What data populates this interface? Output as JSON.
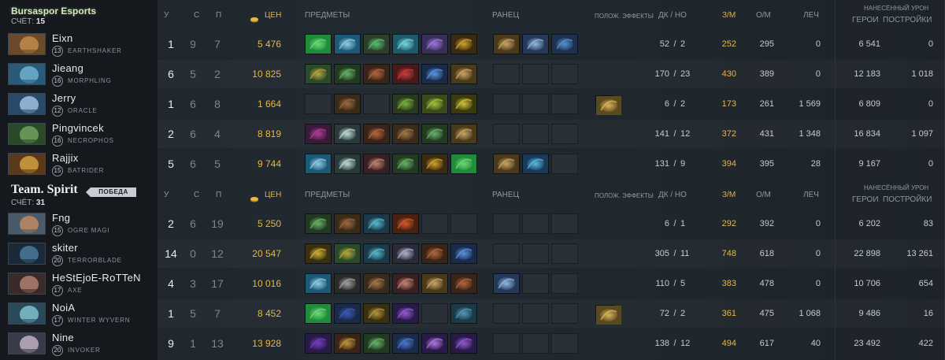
{
  "teams": [
    {
      "name": "Bursaspor Esports",
      "score_label": "СЧЁТ:",
      "score": "15",
      "headers": {
        "k": "У",
        "d": "С",
        "a": "П",
        "nw": "ЦЕН",
        "items": "ПРЕДМЕТЫ",
        "backpack": "РАНЕЦ",
        "buffs": "ПОЛОЖ. ЭФФЕКТЫ",
        "lhdn": "ДК / НО",
        "xpm": "З/М",
        "gpm": "О/М",
        "heal": "ЛЕЧ",
        "dmg": "НАНЕСЁННЫЙ УРОН",
        "hero_dmg": "ГЕРОИ",
        "tower_dmg": "ПОСТРОЙКИ"
      },
      "players": [
        {
          "name": "Eixn",
          "level": "13",
          "hero": "EARTHSHAKER",
          "k": "1",
          "d": "9",
          "a": "7",
          "nw": "5 476",
          "lh": "52",
          "dn": "2",
          "xpm": "252",
          "gpm": "295",
          "heal": "0",
          "hero_dmg": "6 541",
          "tower_dmg": "0",
          "items": [
            {
              "c": "#1f8c3b",
              "c2": "#7ae07d"
            },
            {
              "c": "#1c5a78",
              "c2": "#9fd8f0"
            },
            {
              "c": "#2d3f2a",
              "c2": "#5ad07a"
            },
            {
              "c": "#1f5a6a",
              "c2": "#7de6e8"
            },
            {
              "c": "#3a2f5a",
              "c2": "#a67fe8"
            },
            {
              "c": "#3a2a10",
              "c2": "#e0b030"
            }
          ],
          "backpack": [
            {
              "c": "#4a3a1a",
              "c2": "#d8b070"
            },
            {
              "c": "#253a5a",
              "c2": "#9ec8f0"
            },
            {
              "c": "#1d3050",
              "c2": "#5aa0e0"
            }
          ],
          "buff": null
        },
        {
          "name": "Jieang",
          "level": "16",
          "hero": "MORPHLING",
          "k": "6",
          "d": "5",
          "a": "2",
          "nw": "10 825",
          "lh": "170",
          "dn": "23",
          "xpm": "430",
          "gpm": "389",
          "heal": "0",
          "hero_dmg": "12 183",
          "tower_dmg": "1 018",
          "items": [
            {
              "c": "#2a4a2a",
              "c2": "#c8b040"
            },
            {
              "c": "#223a22",
              "c2": "#70c070"
            },
            {
              "c": "#3a2418",
              "c2": "#c07040"
            },
            {
              "c": "#4a1a1a",
              "c2": "#d84040"
            },
            {
              "c": "#1a2a4a",
              "c2": "#60a0f0"
            },
            {
              "c": "#4a3a1a",
              "c2": "#d8b070"
            }
          ],
          "backpack": [
            null,
            null,
            null
          ],
          "buff": null
        },
        {
          "name": "Jerry",
          "level": "12",
          "hero": "ORACLE",
          "k": "1",
          "d": "6",
          "a": "8",
          "nw": "1 664",
          "lh": "6",
          "dn": "2",
          "xpm": "173",
          "gpm": "261",
          "heal": "1 569",
          "hero_dmg": "6 809",
          "tower_dmg": "0",
          "items": [
            null,
            {
              "c": "#3a2a18",
              "c2": "#a87040"
            },
            null,
            {
              "c": "#2a3a20",
              "c2": "#80c040"
            },
            {
              "c": "#3a4a1a",
              "c2": "#b0d040"
            },
            {
              "c": "#3a3a10",
              "c2": "#e0d040"
            }
          ],
          "backpack": [
            null,
            null,
            null
          ],
          "buff": {
            "c": "#5a4a20",
            "c2": "#e8c060"
          }
        },
        {
          "name": "Pingvincek",
          "level": "16",
          "hero": "NECROPHOS",
          "k": "2",
          "d": "6",
          "a": "4",
          "nw": "8 819",
          "lh": "141",
          "dn": "12",
          "xpm": "372",
          "gpm": "431",
          "heal": "1 348",
          "hero_dmg": "16 834",
          "tower_dmg": "1 097",
          "items": [
            {
              "c": "#3a1a3a",
              "c2": "#c040a0"
            },
            {
              "c": "#2a3a3a",
              "c2": "#d0f0e8"
            },
            {
              "c": "#3a2418",
              "c2": "#c07040"
            },
            {
              "c": "#3a2a1a",
              "c2": "#b08050"
            },
            {
              "c": "#223a22",
              "c2": "#70c070"
            },
            {
              "c": "#4a3a1a",
              "c2": "#d8b070"
            }
          ],
          "backpack": [
            null,
            null,
            null
          ],
          "buff": null
        },
        {
          "name": "Rajjix",
          "level": "15",
          "hero": "BATRIDER",
          "k": "5",
          "d": "6",
          "a": "5",
          "nw": "9 744",
          "lh": "131",
          "dn": "9",
          "xpm": "394",
          "gpm": "395",
          "heal": "28",
          "hero_dmg": "9 167",
          "tower_dmg": "0",
          "items": [
            {
              "c": "#1c5a78",
              "c2": "#9fd8f0"
            },
            {
              "c": "#2a3a3a",
              "c2": "#d0f0e8"
            },
            {
              "c": "#3a2020",
              "c2": "#d09080"
            },
            {
              "c": "#223a22",
              "c2": "#70c070"
            },
            {
              "c": "#3a2a10",
              "c2": "#e0b030"
            },
            {
              "c": "#1f8c3b",
              "c2": "#7ae07d"
            }
          ],
          "backpack": [
            {
              "c": "#4a3a1a",
              "c2": "#d8b070"
            },
            {
              "c": "#1a3a5a",
              "c2": "#60c8f0"
            },
            null
          ],
          "buff": null
        }
      ]
    },
    {
      "name": "Team. Spirit",
      "win_label": "ПОБЕДА",
      "score_label": "СЧЁТ:",
      "score": "31",
      "headers": {
        "k": "У",
        "d": "С",
        "a": "П",
        "nw": "ЦЕН",
        "items": "ПРЕДМЕТЫ",
        "backpack": "РАНЕЦ",
        "buffs": "ПОЛОЖ. ЭФФЕКТЫ",
        "lhdn": "ДК / НО",
        "xpm": "З/М",
        "gpm": "О/М",
        "heal": "ЛЕЧ",
        "dmg": "НАНЕСЁННЫЙ УРОН",
        "hero_dmg": "ГЕРОИ",
        "tower_dmg": "ПОСТРОЙКИ"
      },
      "players": [
        {
          "name": "Fng",
          "level": "15",
          "hero": "OGRE MAGI",
          "k": "2",
          "d": "6",
          "a": "19",
          "nw": "5 250",
          "lh": "6",
          "dn": "1",
          "xpm": "292",
          "gpm": "392",
          "heal": "0",
          "hero_dmg": "6 202",
          "tower_dmg": "83",
          "items": [
            {
              "c": "#223a22",
              "c2": "#70c070"
            },
            {
              "c": "#3a2a18",
              "c2": "#a87040"
            },
            {
              "c": "#1a3a4a",
              "c2": "#60c8d8"
            },
            {
              "c": "#4a2010",
              "c2": "#e06030"
            },
            null,
            null
          ],
          "backpack": [
            null,
            null,
            null
          ],
          "buff": null
        },
        {
          "name": "skiter",
          "level": "20",
          "hero": "TERRORBLADE",
          "k": "14",
          "d": "0",
          "a": "12",
          "nw": "20 547",
          "lh": "305",
          "dn": "11",
          "xpm": "748",
          "gpm": "618",
          "heal": "0",
          "hero_dmg": "22 898",
          "tower_dmg": "13 261",
          "items": [
            {
              "c": "#3a3010",
              "c2": "#e0c040"
            },
            {
              "c": "#2a4a2a",
              "c2": "#c8b040"
            },
            {
              "c": "#1a3a4a",
              "c2": "#60c8d8"
            },
            {
              "c": "#2a2a3a",
              "c2": "#c0c0e0"
            },
            {
              "c": "#3a2418",
              "c2": "#c07040"
            },
            {
              "c": "#1a2a4a",
              "c2": "#60a0f0"
            }
          ],
          "backpack": [
            null,
            null,
            null
          ],
          "buff": null
        },
        {
          "name": "HeStEjoE-RoTTeN",
          "level": "17",
          "hero": "AXE",
          "k": "4",
          "d": "3",
          "a": "17",
          "nw": "10 016",
          "lh": "110",
          "dn": "5",
          "xpm": "383",
          "gpm": "478",
          "heal": "0",
          "hero_dmg": "10 706",
          "tower_dmg": "654",
          "items": [
            {
              "c": "#1c5a78",
              "c2": "#9fd8f0"
            },
            {
              "c": "#2a2a2a",
              "c2": "#b0b0b0"
            },
            {
              "c": "#3a2a1a",
              "c2": "#b08050"
            },
            {
              "c": "#3a2020",
              "c2": "#d09080"
            },
            {
              "c": "#4a3a1a",
              "c2": "#d8b070"
            },
            {
              "c": "#3a2418",
              "c2": "#c07040"
            }
          ],
          "backpack": [
            {
              "c": "#253a5a",
              "c2": "#9ec8f0"
            },
            null,
            null
          ],
          "buff": null
        },
        {
          "name": "NoiA",
          "level": "17",
          "hero": "WINTER WYVERN",
          "k": "1",
          "d": "5",
          "a": "7",
          "nw": "8 452",
          "lh": "72",
          "dn": "2",
          "xpm": "361",
          "gpm": "475",
          "heal": "1 068",
          "hero_dmg": "9 486",
          "tower_dmg": "16",
          "items": [
            {
              "c": "#1f8c3b",
              "c2": "#7ae07d"
            },
            {
              "c": "#1a2a4a",
              "c2": "#4060c0"
            },
            {
              "c": "#3a3010",
              "c2": "#c0a040"
            },
            {
              "c": "#2a1a4a",
              "c2": "#a060e0"
            },
            null,
            {
              "c": "#1a3a4a",
              "c2": "#60a0c0"
            }
          ],
          "backpack": [
            null,
            null,
            null
          ],
          "buff": {
            "c": "#5a4a20",
            "c2": "#e8c060"
          }
        },
        {
          "name": "Nine",
          "level": "20",
          "hero": "INVOKER",
          "k": "9",
          "d": "1",
          "a": "13",
          "nw": "13 928",
          "lh": "138",
          "dn": "12",
          "xpm": "494",
          "gpm": "617",
          "heal": "40",
          "hero_dmg": "23 492",
          "tower_dmg": "422",
          "items": [
            {
              "c": "#2a1a4a",
              "c2": "#8040d0"
            },
            {
              "c": "#3a2418",
              "c2": "#d0a040"
            },
            {
              "c": "#223a22",
              "c2": "#70c070"
            },
            {
              "c": "#1a2a4a",
              "c2": "#5080e0"
            },
            {
              "c": "#2a1a4a",
              "c2": "#c080f0"
            },
            {
              "c": "#2a1a4a",
              "c2": "#a060e0"
            }
          ],
          "backpack": [
            null,
            null,
            null
          ],
          "buff": null
        }
      ]
    }
  ],
  "portrait_colors": [
    [
      "#6a4a2a",
      "#c08a4a"
    ],
    [
      "#2a5a7a",
      "#70b0d0"
    ],
    [
      "#2a4a6a",
      "#a0c0e0"
    ],
    [
      "#2a4a2a",
      "#70a060"
    ],
    [
      "#5a3a1a",
      "#d0a040"
    ],
    [
      "#4a5a6a",
      "#c08a60"
    ],
    [
      "#1a2a3a",
      "#4a7a9a"
    ],
    [
      "#3a2a2a",
      "#b08070"
    ],
    [
      "#2a4a5a",
      "#80c0d0"
    ],
    [
      "#3a3a4a",
      "#c0b0c0"
    ]
  ]
}
